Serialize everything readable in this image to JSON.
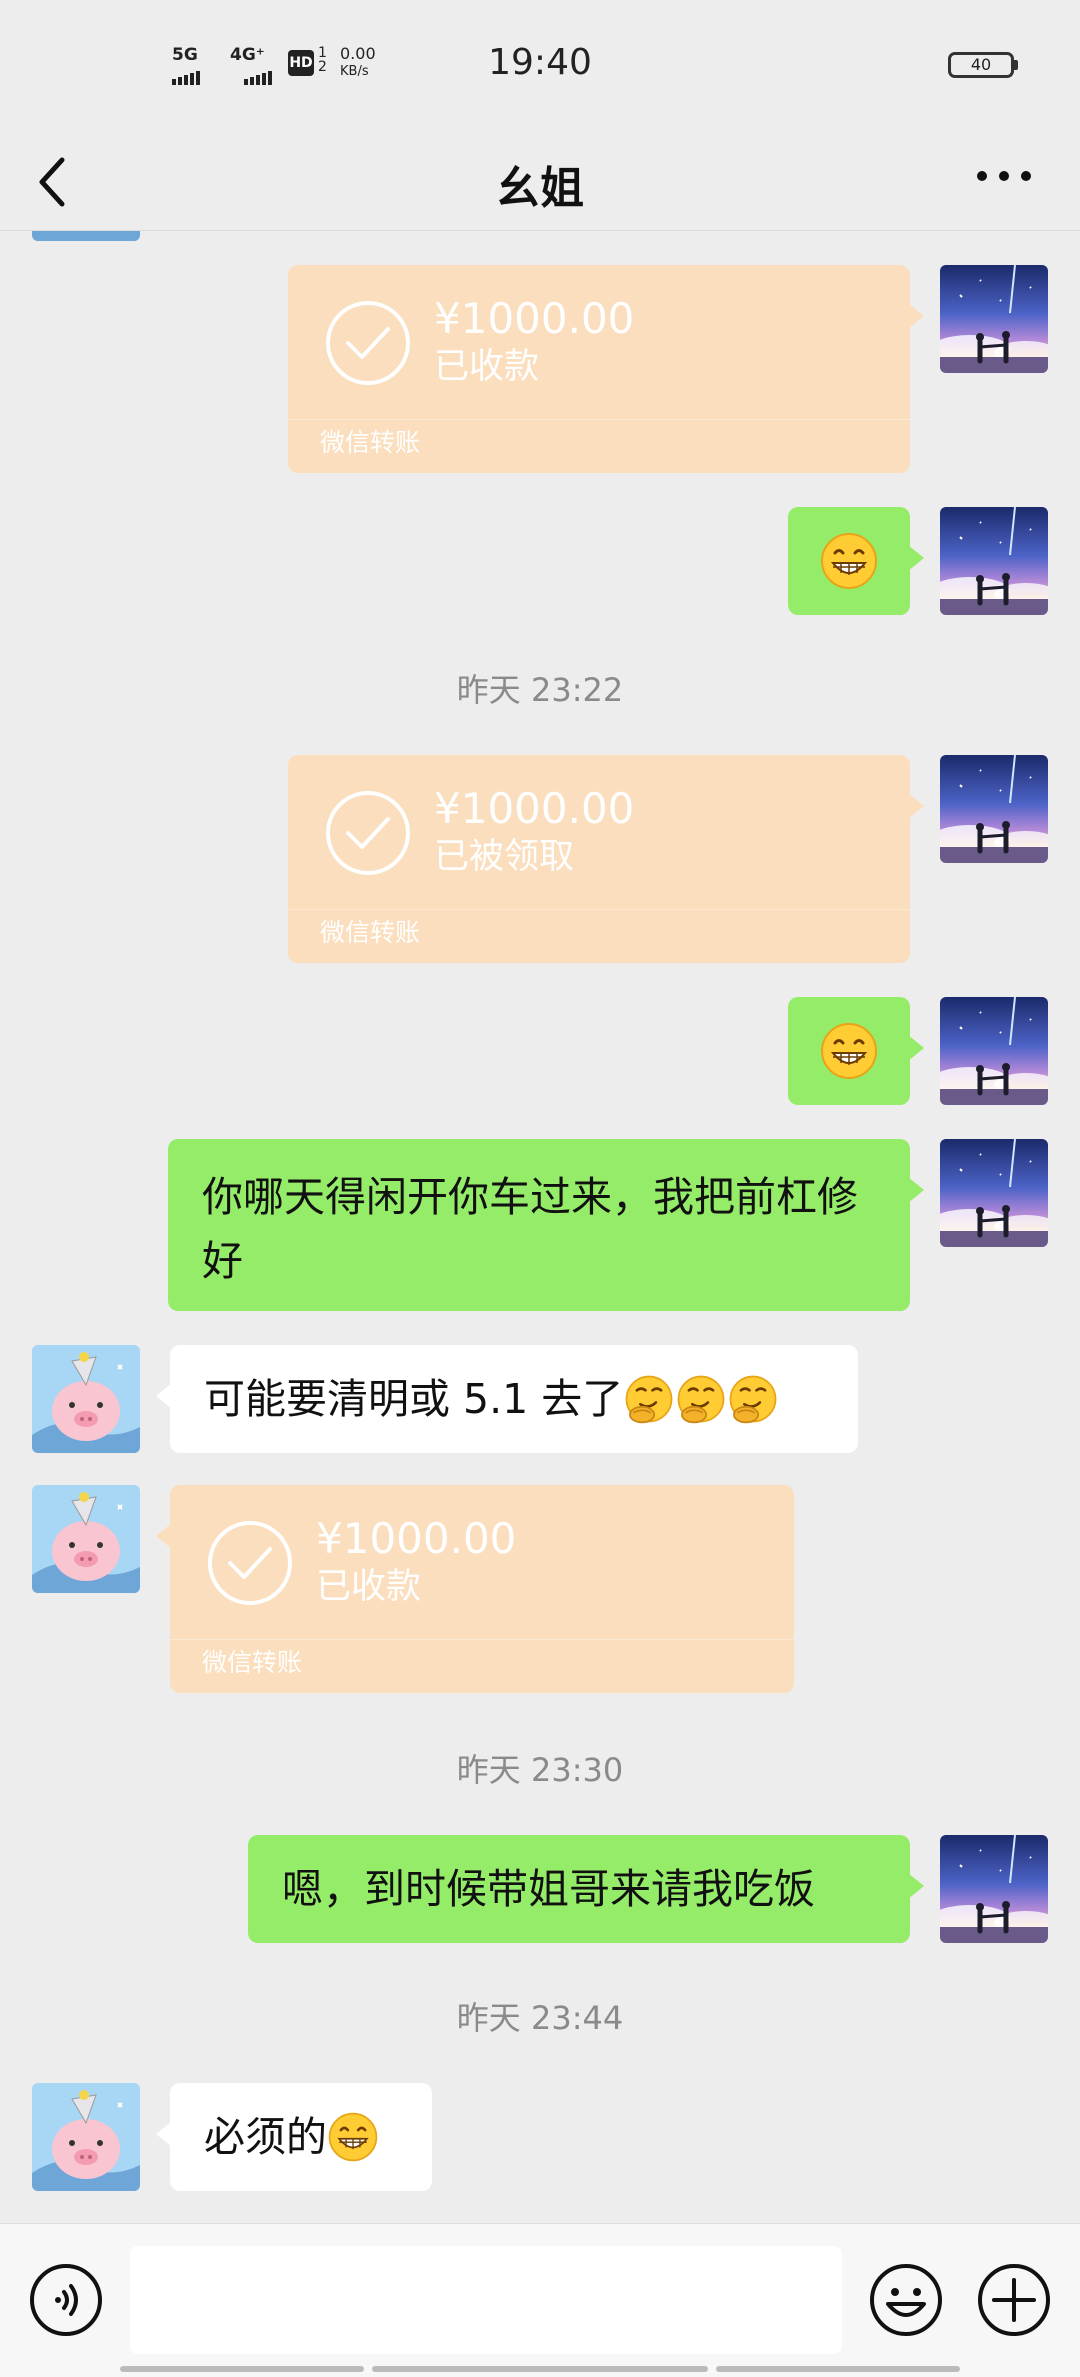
{
  "status_bar": {
    "net1": "5G",
    "net2": "4G⁺",
    "hd": "HD",
    "sim": "1\n2",
    "speed_value": "0.00",
    "speed_unit": "KB/s",
    "time": "19:40",
    "battery": "40"
  },
  "nav": {
    "title": "幺姐"
  },
  "chat": {
    "messages": {
      "t1": {
        "amount": "¥1000.00",
        "status": "已收款",
        "label": "微信转账"
      },
      "ts1": "昨天 23:22",
      "t2": {
        "amount": "¥1000.00",
        "status": "已被领取",
        "label": "微信转账"
      },
      "m1": "你哪天得闲开你车过来，我把前杠修好",
      "m2": "可能要清明或 5.1 去了",
      "t3": {
        "amount": "¥1000.00",
        "status": "已收款",
        "label": "微信转账"
      },
      "ts2": "昨天 23:30",
      "m3": "嗯，到时候带姐哥来请我吃饭",
      "ts3": "昨天 23:44",
      "m4": "必须的"
    }
  },
  "input": {
    "value": ""
  },
  "icons": {
    "back": "back-arrow-icon",
    "more": "more-dots-icon",
    "voice": "voice-icon",
    "emoji": "emoji-icon",
    "plus": "plus-icon",
    "check": "check-circle-icon"
  },
  "colors": {
    "background": "#ededed",
    "sent_bubble": "#95ec69",
    "received_bubble": "#ffffff",
    "transfer_card": "#fbdebd"
  }
}
